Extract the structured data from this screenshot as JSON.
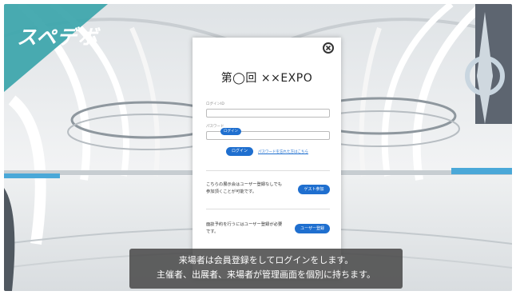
{
  "brand": {
    "logo_text": "スペデボ"
  },
  "dialog": {
    "title": "第◯回 ××EXPO",
    "login_id_label": "ログインID",
    "password_label": "パスワード",
    "tooltip_label": "ログイン",
    "login_button": "ログイン",
    "forgot_password_link": "パスワードを忘れた方はこちら",
    "guest_text": "こちらの展示会はユーザー登録なしでも参加頂くことが可能です。",
    "guest_button": "ゲスト参加",
    "register_text": "面談予約を行うにはユーザー登録が必要です。",
    "register_button": "ユーザー登録"
  },
  "caption": {
    "line1": "来場者は会員登録をしてログインをします。",
    "line2": "主催者、出展者、来場者が管理画面を個別に持ちます。"
  },
  "colors": {
    "accent": "#1f6fcf",
    "logo_bg": "#3fa6ad",
    "caption_bg": "#464646"
  },
  "icons": {
    "close": "close-circle-icon"
  }
}
